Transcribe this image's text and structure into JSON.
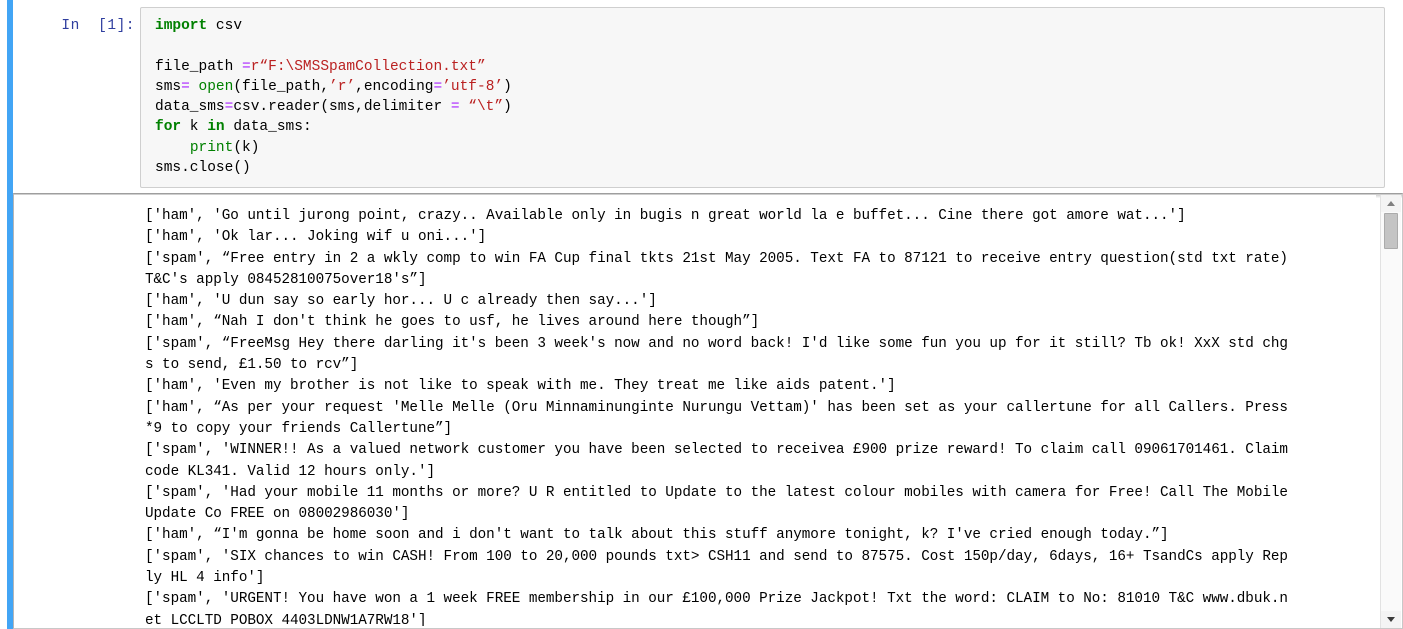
{
  "notebook": {
    "cell_prompt": "In  [1]:",
    "selected": true,
    "accent_color": "#42a5f5"
  },
  "code_cell": {
    "language": "python",
    "background": "#f7f7f7",
    "lines": [
      [
        {
          "t": "import",
          "c": "kw"
        },
        {
          "t": " csv",
          "c": "plain"
        }
      ],
      [],
      [
        {
          "t": "file_path ",
          "c": "plain"
        },
        {
          "t": "=",
          "c": "op"
        },
        {
          "t": "r“F:\\SMSSpamCollection.txt”",
          "c": "str"
        }
      ],
      [
        {
          "t": "sms",
          "c": "plain"
        },
        {
          "t": "=",
          "c": "op"
        },
        {
          "t": " ",
          "c": "plain"
        },
        {
          "t": "open",
          "c": "builtin"
        },
        {
          "t": "(file_path,",
          "c": "plain"
        },
        {
          "t": "’r’",
          "c": "str"
        },
        {
          "t": ",encoding",
          "c": "plain"
        },
        {
          "t": "=",
          "c": "op"
        },
        {
          "t": "’utf-8’",
          "c": "str"
        },
        {
          "t": ")",
          "c": "plain"
        }
      ],
      [
        {
          "t": "data_sms",
          "c": "plain"
        },
        {
          "t": "=",
          "c": "op"
        },
        {
          "t": "csv.reader(sms,delimiter ",
          "c": "plain"
        },
        {
          "t": "=",
          "c": "op"
        },
        {
          "t": " ",
          "c": "plain"
        },
        {
          "t": "“\\t”",
          "c": "str"
        },
        {
          "t": ")",
          "c": "plain"
        }
      ],
      [
        {
          "t": "for",
          "c": "kw"
        },
        {
          "t": " k ",
          "c": "plain"
        },
        {
          "t": "in",
          "c": "kw"
        },
        {
          "t": " data_sms:",
          "c": "plain"
        }
      ],
      [
        {
          "t": "    ",
          "c": "plain"
        },
        {
          "t": "print",
          "c": "builtin"
        },
        {
          "t": "(k)",
          "c": "plain"
        }
      ],
      [
        {
          "t": "sms.close()",
          "c": "plain"
        }
      ]
    ]
  },
  "output": {
    "stream": "stdout",
    "lines": [
      "['ham', 'Go until jurong point, crazy.. Available only in bugis n great world la e buffet... Cine there got amore wat...']",
      "['ham', 'Ok lar... Joking wif u oni...']",
      "['spam', “Free entry in 2 a wkly comp to win FA Cup final tkts 21st May 2005. Text FA to 87121 to receive entry question(std txt rate)",
      "T&C's apply 08452810075over18's”]",
      "['ham', 'U dun say so early hor... U c already then say...']",
      "['ham', “Nah I don't think he goes to usf, he lives around here though”]",
      "['spam', “FreeMsg Hey there darling it's been 3 week's now and no word back! I'd like some fun you up for it still? Tb ok! XxX std chg",
      "s to send, £1.50 to rcv”]",
      "['ham', 'Even my brother is not like to speak with me. They treat me like aids patent.']",
      "['ham', “As per your request 'Melle Melle (Oru Minnaminunginte Nurungu Vettam)' has been set as your callertune for all Callers. Press",
      "*9 to copy your friends Callertune”]",
      "['spam', 'WINNER!! As a valued network customer you have been selected to receivea £900 prize reward! To claim call 09061701461. Claim",
      "code KL341. Valid 12 hours only.']",
      "['spam', 'Had your mobile 11 months or more? U R entitled to Update to the latest colour mobiles with camera for Free! Call The Mobile",
      "Update Co FREE on 08002986030']",
      "['ham', “I'm gonna be home soon and i don't want to talk about this stuff anymore tonight, k? I've cried enough today.”]",
      "['spam', 'SIX chances to win CASH! From 100 to 20,000 pounds txt> CSH11 and send to 87575. Cost 150p/day, 6days, 16+ TsandCs apply Rep",
      "ly HL 4 info']",
      "['spam', 'URGENT! You have won a 1 week FREE membership in our £100,000 Prize Jackpot! Txt the word: CLAIM to No: 81010 T&C www.dbuk.n",
      "et LCCLTD POBOX 4403LDNW1A7RW18']"
    ]
  },
  "scrollbar": {
    "orientation": "vertical",
    "up_arrow": "▲",
    "down_arrow": "▼",
    "thumb_position_pct": 3
  }
}
